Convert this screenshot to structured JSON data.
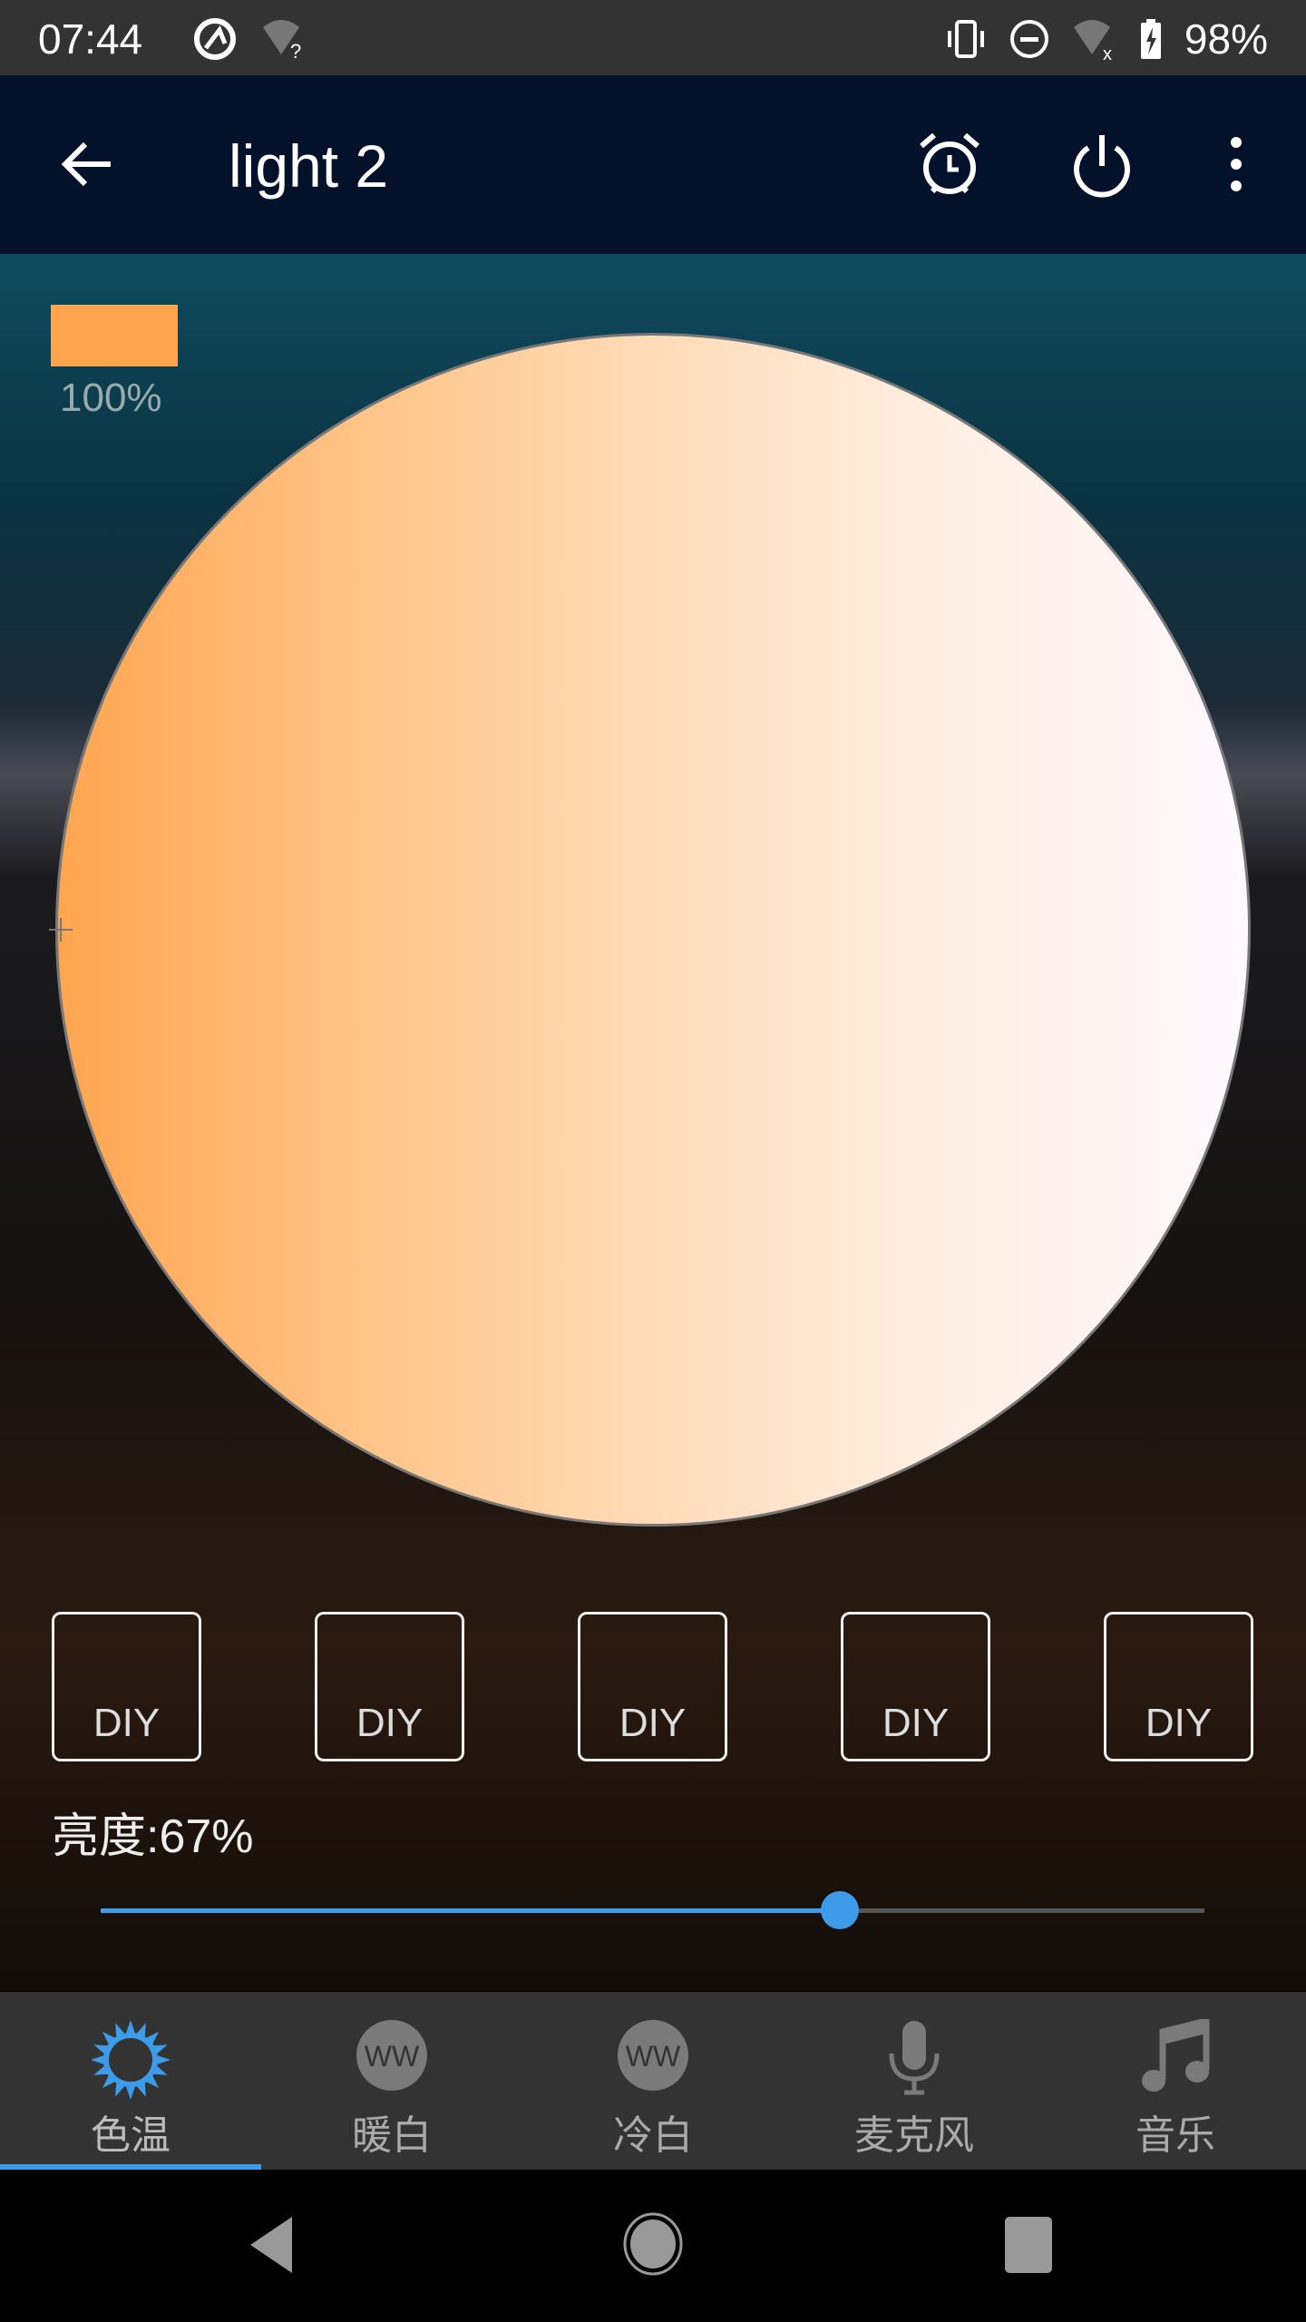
{
  "status_bar": {
    "time": "07:44",
    "battery": "98%",
    "icons": [
      "sync-icon",
      "wifi-unknown-icon",
      "vibrate-icon",
      "dnd-icon",
      "wifi-off-icon",
      "battery-charging-icon"
    ]
  },
  "app_bar": {
    "title": "light 2",
    "icons": [
      "back-arrow-icon",
      "alarm-icon",
      "power-icon",
      "more-vert-icon"
    ]
  },
  "color_preview": {
    "color": "#ffa550",
    "percent": "100%"
  },
  "color_wheel": {
    "warm_color": "#ffa550",
    "cool_color": "#fff8ff"
  },
  "diy_buttons": [
    {
      "label": "DIY"
    },
    {
      "label": "DIY"
    },
    {
      "label": "DIY"
    },
    {
      "label": "DIY"
    },
    {
      "label": "DIY"
    }
  ],
  "brightness": {
    "label": "亮度:67%",
    "value": 67,
    "accent": "#3d9be9"
  },
  "tabs": [
    {
      "label": "色温",
      "icon": "sun-icon",
      "active": true
    },
    {
      "label": "暖白",
      "icon": "ww-icon",
      "icon_text": "WW"
    },
    {
      "label": "冷白",
      "icon": "ww-icon",
      "icon_text": "WW"
    },
    {
      "label": "麦克风",
      "icon": "microphone-icon"
    },
    {
      "label": "音乐",
      "icon": "music-note-icon"
    }
  ]
}
